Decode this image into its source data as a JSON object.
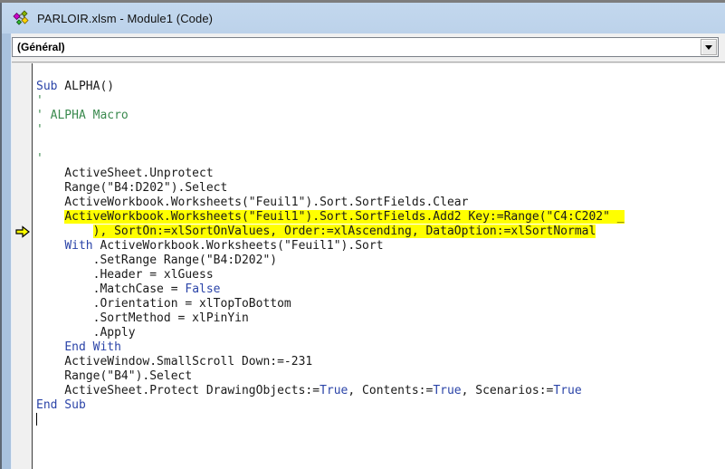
{
  "window": {
    "title": "PARLOIR.xlsm - Module1 (Code)",
    "icon": "vba-module-icon"
  },
  "object_dropdown": {
    "value": "(Général)"
  },
  "colors": {
    "title_blue": "#bcd2ea",
    "frame_blue": "#a9c2de",
    "exec_highlight": "#ffff00",
    "keyword_blue": "#2b44a8",
    "comment_green": "#3a8a4e",
    "exec_arrow_fill": "#ffff00"
  },
  "code": {
    "language": "vba",
    "lines": [
      {
        "segments": [
          [
            "kw",
            "Sub"
          ],
          [
            "plain",
            " ALPHA()"
          ]
        ]
      },
      {
        "segments": [
          [
            "cmt",
            "'"
          ]
        ]
      },
      {
        "segments": [
          [
            "cmt",
            "' ALPHA Macro"
          ]
        ]
      },
      {
        "segments": [
          [
            "cmt",
            "'"
          ]
        ]
      },
      {
        "segments": []
      },
      {
        "segments": [
          [
            "cmt",
            "'"
          ]
        ]
      },
      {
        "segments": [
          [
            "plain",
            "    ActiveSheet.Unprotect"
          ]
        ]
      },
      {
        "segments": [
          [
            "plain",
            "    Range(\"B4:D202\").Select"
          ]
        ]
      },
      {
        "segments": [
          [
            "plain",
            "    ActiveWorkbook.Worksheets(\"Feuil1\").Sort.SortFields.Clear"
          ]
        ]
      },
      {
        "indent": "    ",
        "highlight": true,
        "segments": [
          [
            "plain",
            "ActiveWorkbook.Worksheets(\"Feuil1\").Sort.SortFields.Add2 Key:=Range(\"C4:C202\" _"
          ]
        ]
      },
      {
        "indent": "        ",
        "highlight": true,
        "indicator": true,
        "segments": [
          [
            "plain",
            "), SortOn:=xlSortOnValues, Order:=xlAscending, DataOption:=xlSortNormal"
          ]
        ]
      },
      {
        "segments": [
          [
            "plain",
            "    "
          ],
          [
            "kw",
            "With"
          ],
          [
            "plain",
            " ActiveWorkbook.Worksheets(\"Feuil1\").Sort"
          ]
        ]
      },
      {
        "segments": [
          [
            "plain",
            "        .SetRange Range(\"B4:D202\")"
          ]
        ]
      },
      {
        "segments": [
          [
            "plain",
            "        .Header = xlGuess"
          ]
        ]
      },
      {
        "segments": [
          [
            "plain",
            "        .MatchCase = "
          ],
          [
            "kw",
            "False"
          ]
        ]
      },
      {
        "segments": [
          [
            "plain",
            "        .Orientation = xlTopToBottom"
          ]
        ]
      },
      {
        "segments": [
          [
            "plain",
            "        .SortMethod = xlPinYin"
          ]
        ]
      },
      {
        "segments": [
          [
            "plain",
            "        .Apply"
          ]
        ]
      },
      {
        "segments": [
          [
            "plain",
            "    "
          ],
          [
            "kw",
            "End With"
          ]
        ]
      },
      {
        "segments": [
          [
            "plain",
            "    ActiveWindow.SmallScroll Down:=-231"
          ]
        ]
      },
      {
        "segments": [
          [
            "plain",
            "    Range(\"B4\").Select"
          ]
        ]
      },
      {
        "segments": [
          [
            "plain",
            "    ActiveSheet.Protect DrawingObjects:="
          ],
          [
            "kw",
            "True"
          ],
          [
            "plain",
            ", Contents:="
          ],
          [
            "kw",
            "True"
          ],
          [
            "plain",
            ", Scenarios:="
          ],
          [
            "kw",
            "True"
          ]
        ]
      },
      {
        "segments": [
          [
            "kw",
            "End Sub"
          ]
        ]
      },
      {
        "segments": [],
        "caret": true
      }
    ]
  }
}
